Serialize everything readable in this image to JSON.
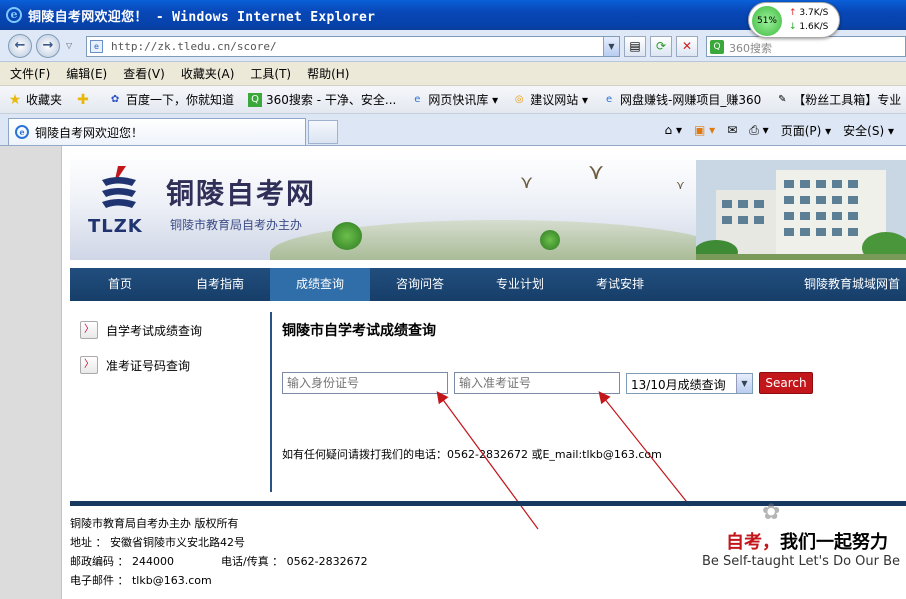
{
  "window": {
    "title": "铜陵自考网欢迎您！ - Windows Internet Explorer",
    "net_percent": "51%",
    "net_up": "3.7K/S",
    "net_down": "1.6K/S"
  },
  "addressbar": {
    "url": "http://zk.tledu.cn/score/",
    "search_placeholder": "360搜索"
  },
  "menu": [
    "文件(F)",
    "编辑(E)",
    "查看(V)",
    "收藏夹(A)",
    "工具(T)",
    "帮助(H)"
  ],
  "favorites": {
    "label": "收藏夹",
    "items": [
      "百度一下，你就知道",
      "360搜索 - 干净、安全...",
      "网页快讯库 ▾",
      "建议网站 ▾",
      "网盘赚钱-网赚项目_赚360",
      "【粉丝工具箱】专业"
    ]
  },
  "tabs": {
    "active": "铜陵自考网欢迎您！",
    "commands": [
      "页面(P) ▾",
      "安全(S) ▾"
    ]
  },
  "site": {
    "logo_text": "TLZK",
    "title": "铜陵自考网",
    "subtitle": "铜陵市教育局自考办主办"
  },
  "nav": [
    "首页",
    "自考指南",
    "成绩查询",
    "咨询问答",
    "专业计划",
    "考试安排",
    "铜陵教育城域网首"
  ],
  "nav_active": "成绩查询",
  "sidebar": [
    "自学考试成绩查询",
    "准考证号码查询"
  ],
  "query": {
    "title": "铜陵市自学考试成绩查询",
    "id_placeholder": "输入身份证号",
    "ticket_placeholder": "输入准考证号",
    "session_selected": "13/10月成绩查询",
    "search_label": "Search",
    "contact": "如有任何疑问请拨打我们的电话：0562-2832672 或E_mail:tlkb@163.com"
  },
  "footer": {
    "copyright": "铜陵市教育局自考办主办  版权所有",
    "address": "地址 ： 安徽省铜陵市义安北路42号",
    "postcode": "邮政编码 ： 244000",
    "phone": "电话/传真 ： 0562-2832672",
    "email": "电子邮件 ： tlkb@163.com"
  },
  "slogan": {
    "red": "自考，",
    "black": "我们一起努力",
    "english": "Be Self-taught Let's Do Our Be"
  },
  "colors": {
    "nav_bg": "#1b4473",
    "nav_active": "#2f6ea8",
    "search_button": "#c3161b",
    "annotation_arrow": "#c3161b"
  }
}
